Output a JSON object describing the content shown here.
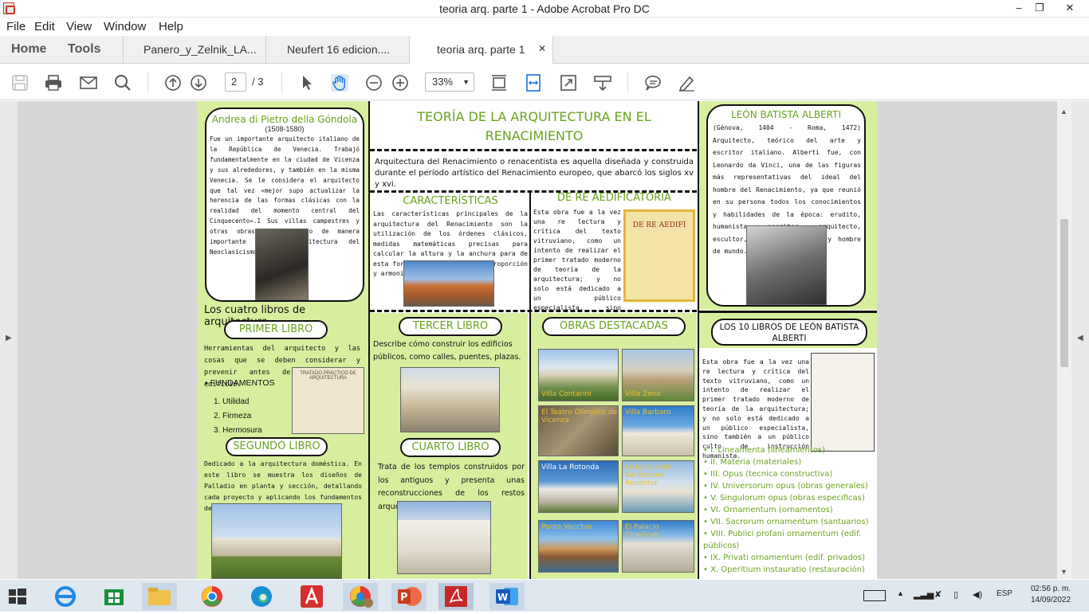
{
  "window": {
    "title": "teoria arq. parte 1 - Adobe Acrobat Pro DC",
    "minimize": "–",
    "maximize": "❐",
    "close": "✕"
  },
  "menu": [
    "File",
    "Edit",
    "View",
    "Window",
    "Help"
  ],
  "nav": {
    "home": "Home",
    "tools": "Tools"
  },
  "tabs": [
    {
      "label": "Panero_y_Zelnik_LA..."
    },
    {
      "label": "Neufert 16 edicion...."
    },
    {
      "label": "teoria arq. parte 1",
      "close": "✕"
    }
  ],
  "toolbar": {
    "page_current": "2",
    "page_total": "/ 3",
    "zoom": "33%"
  },
  "doc": {
    "gondola": {
      "title": "Andrea di Pietro della Góndola",
      "dates": "(1508-1580)",
      "text": "Fue un importante arquitecto italiano de la República de Venecia. Trabajó fundamentalmente en la ciudad de Vicenza y sus alrededores, y también en la misma Venecia. Se le considera el arquitecto que tal vez «mejor supo actualizar la herencia de las formas clásicas con la realidad del momento central del Cinquecento».1 Sus villas campestres y otras obras han influido de manera importante en la arquitectura del Neoclasicismo."
    },
    "main_title": "TEORÍA DE LA ARQUITECTURA EN EL RENACIMIENTO",
    "intro": "Arquitectura del Renacimiento o renacentista es aquella diseñada y construida durante el período artístico del Renacimiento europeo, que abarcó los siglos xv y xvi.",
    "caract": {
      "title": "CARACTERÍSTICAS",
      "text": "Las características principales de la arquitectura del Renacimiento son la utilización de los órdenes clásicos, medidas matemáticas precisas para calcular la altura y la anchura para de esta forma alcanzar simetría, proporción y armonía."
    },
    "dere": {
      "title": "DE RE AEDIFICATORIA",
      "text": "Esta obra fue a la vez una re lectura y crítica del texto vitruviano, como un intento de realizar el primer tratado moderno de teoría de la arquitectura; y no solo está dedicado a un público especialista, sino también a un público culto de instrucción humanista.",
      "book": "DE RE AEDIFI"
    },
    "alberti": {
      "title": "LEÓN BATISTA ALBERTI",
      "text": "(Génova, 1404 - Roma, 1472) Arquitecto, teórico del arte y escritor italiano. Alberti fue, con Leonardo da Vinci, una de las figuras más representativas del ideal del hombre del Renacimiento, ya que reunió en su persona todos los conocimientos y habilidades de la época: erudito, humanista, escritor, arquitecto, escultor, pintor, cortesano y hombre de mundo."
    },
    "cuatro": {
      "title": "Los cuatro libros de arquitectura",
      "primer": "PRIMER LIBRO",
      "primer_text": "Herramientas del arquitecto y las cosas que se deben considerar y prevenir antes de construir un edificio.",
      "fundamentos": "FUNDAMENTOS",
      "items": [
        "Utilidad",
        "Firmeza",
        "Hermosura"
      ],
      "book": "TRATADO PRÁCTICO DE ARQUITECTURA",
      "segundo": "SEGUNDO LIBRO",
      "segundo_text": "Dedicado a la arquitectura doméstica. En este libro se muestra los diseños de Palladio en planta y sección, detallando cada proyecto y aplicando los fundamentos del libro I."
    },
    "tercer": {
      "title": "TERCER LIBRO",
      "text": "Describe cómo construir los edificios públicos, como calles, puentes, plazas."
    },
    "cuarto": {
      "title": "CUARTO LIBRO",
      "text": "Trata de los templos construidos por los antiguos y presenta unas reconstrucciones de los restos arqueológicos de Roma."
    },
    "obras": {
      "title": "OBRAS DESTACADAS",
      "items": [
        "Villa Contarini",
        "Villa Zeno",
        "El Teatro Olímpico de Vicenza",
        "Villa Barbaro",
        "Villa La Rotonda",
        "La Iglesia del Santíssimo Redentor",
        "Ponte Vecchio",
        "El Palacio Chiericati"
      ]
    },
    "diez": {
      "title": "LOS 10 LIBROS DE LEÓN BATISTA ALBERTI",
      "text": "Esta obra fue a la vez una re lectura y crítica del texto vitruviano, como un intento de realizar el primer tratado moderno de teoría de la arquitectura; y no solo está dedicado a un público especialista, sino también a un público culto de instrucción humanista.",
      "items": [
        "I. Lineamenta (lineamientos)",
        "II. Materia (materiales)",
        "III. Opus (tecnica constructiva)",
        "IV. Universorum opus (obras generales)",
        "V. Singulorum opus (obras especificas)",
        "VI. Ornamentum (ornamentos)",
        "VII. Sacrorum ornamentum (santuarios)",
        "VIII. Publici profani ornamentum (edif. públicos)",
        "IX. Privati ornamentum (edif. privados)",
        "X. Operitium instauratio (restauración)"
      ]
    }
  },
  "taskbar": {
    "lang": "ESP",
    "time": "02:56 p. m.",
    "date": "14/09/2022"
  }
}
